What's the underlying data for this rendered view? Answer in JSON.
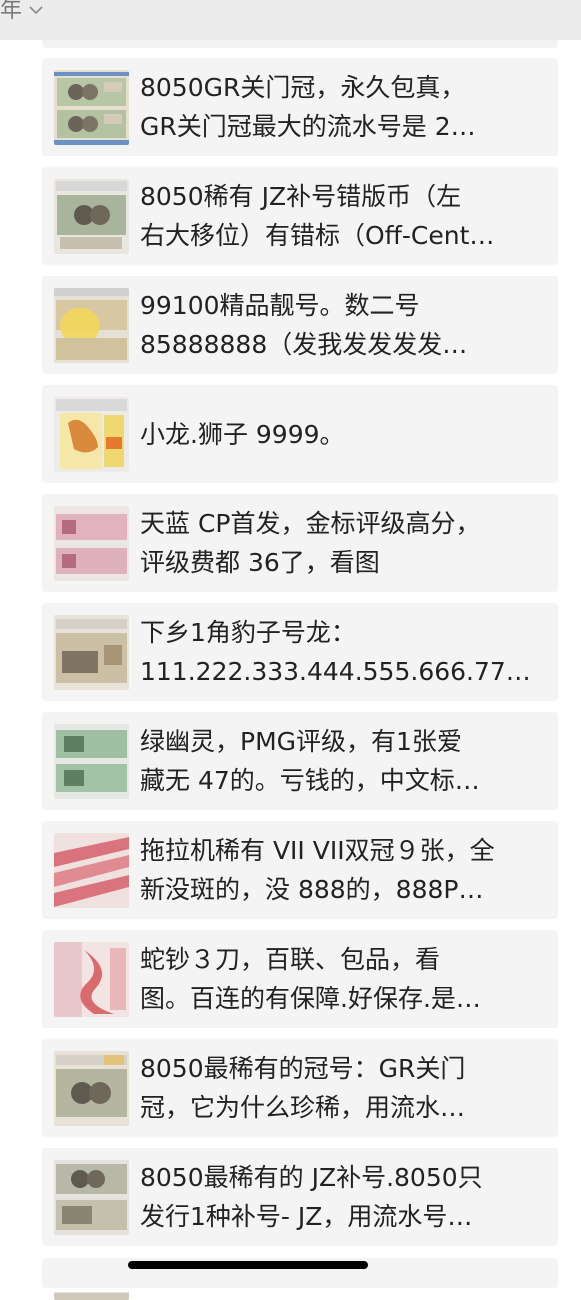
{
  "header": {
    "label": "年"
  },
  "items": [
    {
      "line1": "8050GR关门冠，永久包真，",
      "line2": "GR关门冠最大的流水号是 2…"
    },
    {
      "line1": "8050稀有 JZ补号错版币（左",
      "line2": "右大移位）有错标（Off-Cent…"
    },
    {
      "line1": "99100精品靓号。数二号",
      "line2": "85888888（发我发发发发…"
    },
    {
      "line1": "小龙.狮子 9999。",
      "line2": ""
    },
    {
      "line1": "天蓝 CP首发，金标评级高分，",
      "line2": "评级费都 36了，看图"
    },
    {
      "line1": "下乡1角豹子号龙：",
      "line2": "111.222.333.444.555.666.777…"
    },
    {
      "line1": "绿幽灵，PMG评级，有1张爱",
      "line2": "藏无 47的。亏钱的，中文标…"
    },
    {
      "line1": "拖拉机稀有 VII VII双冠９张，全",
      "line2": "新没斑的，没 888的，888P…"
    },
    {
      "line1": "蛇钞３刀，百联、包品，看",
      "line2": "图。百连的有保障.好保存.是…"
    },
    {
      "line1": "8050最稀有的冠号：GR关门",
      "line2": "冠，它为什么珍稀，用流水…"
    },
    {
      "line1": "8050最稀有的 JZ补号.8050只",
      "line2": "发行1种补号- JZ，用流水号…"
    }
  ]
}
